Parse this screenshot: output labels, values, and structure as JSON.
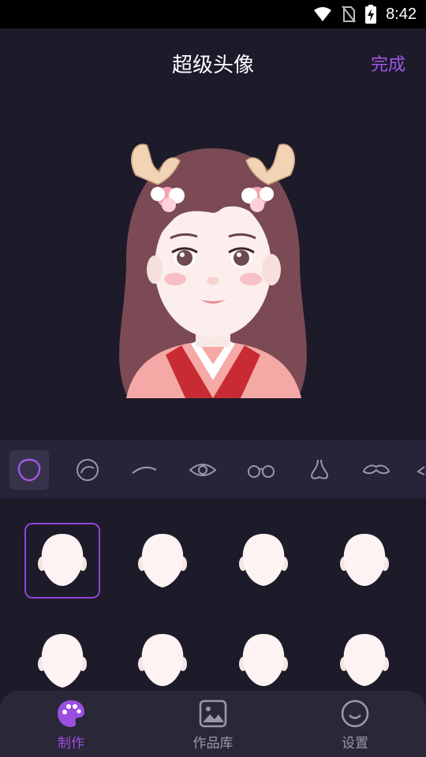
{
  "status_bar": {
    "time": "8:42",
    "icons": [
      "wifi-icon",
      "no-sim-icon",
      "battery-charging-icon"
    ]
  },
  "header": {
    "title": "超级头像",
    "done_label": "完成"
  },
  "colors": {
    "accent": "#9b4fe0",
    "background": "#1d1a2a",
    "category_bar": "#26233a",
    "bottom_nav": "#2a2738"
  },
  "categories": [
    {
      "name": "face-shape-icon",
      "selected": true
    },
    {
      "name": "hair-icon",
      "selected": false
    },
    {
      "name": "eyebrow-icon",
      "selected": false
    },
    {
      "name": "eye-icon",
      "selected": false
    },
    {
      "name": "glasses-icon",
      "selected": false
    },
    {
      "name": "nose-icon",
      "selected": false
    },
    {
      "name": "mustache-icon",
      "selected": false
    },
    {
      "name": "more-icon",
      "selected": false
    }
  ],
  "face_options": {
    "selected_index": 0,
    "count_visible": 8
  },
  "bottom_nav": {
    "items": [
      {
        "label": "制作",
        "icon": "palette-icon",
        "active": true
      },
      {
        "label": "作品库",
        "icon": "gallery-icon",
        "active": false
      },
      {
        "label": "设置",
        "icon": "smile-settings-icon",
        "active": false
      }
    ]
  }
}
